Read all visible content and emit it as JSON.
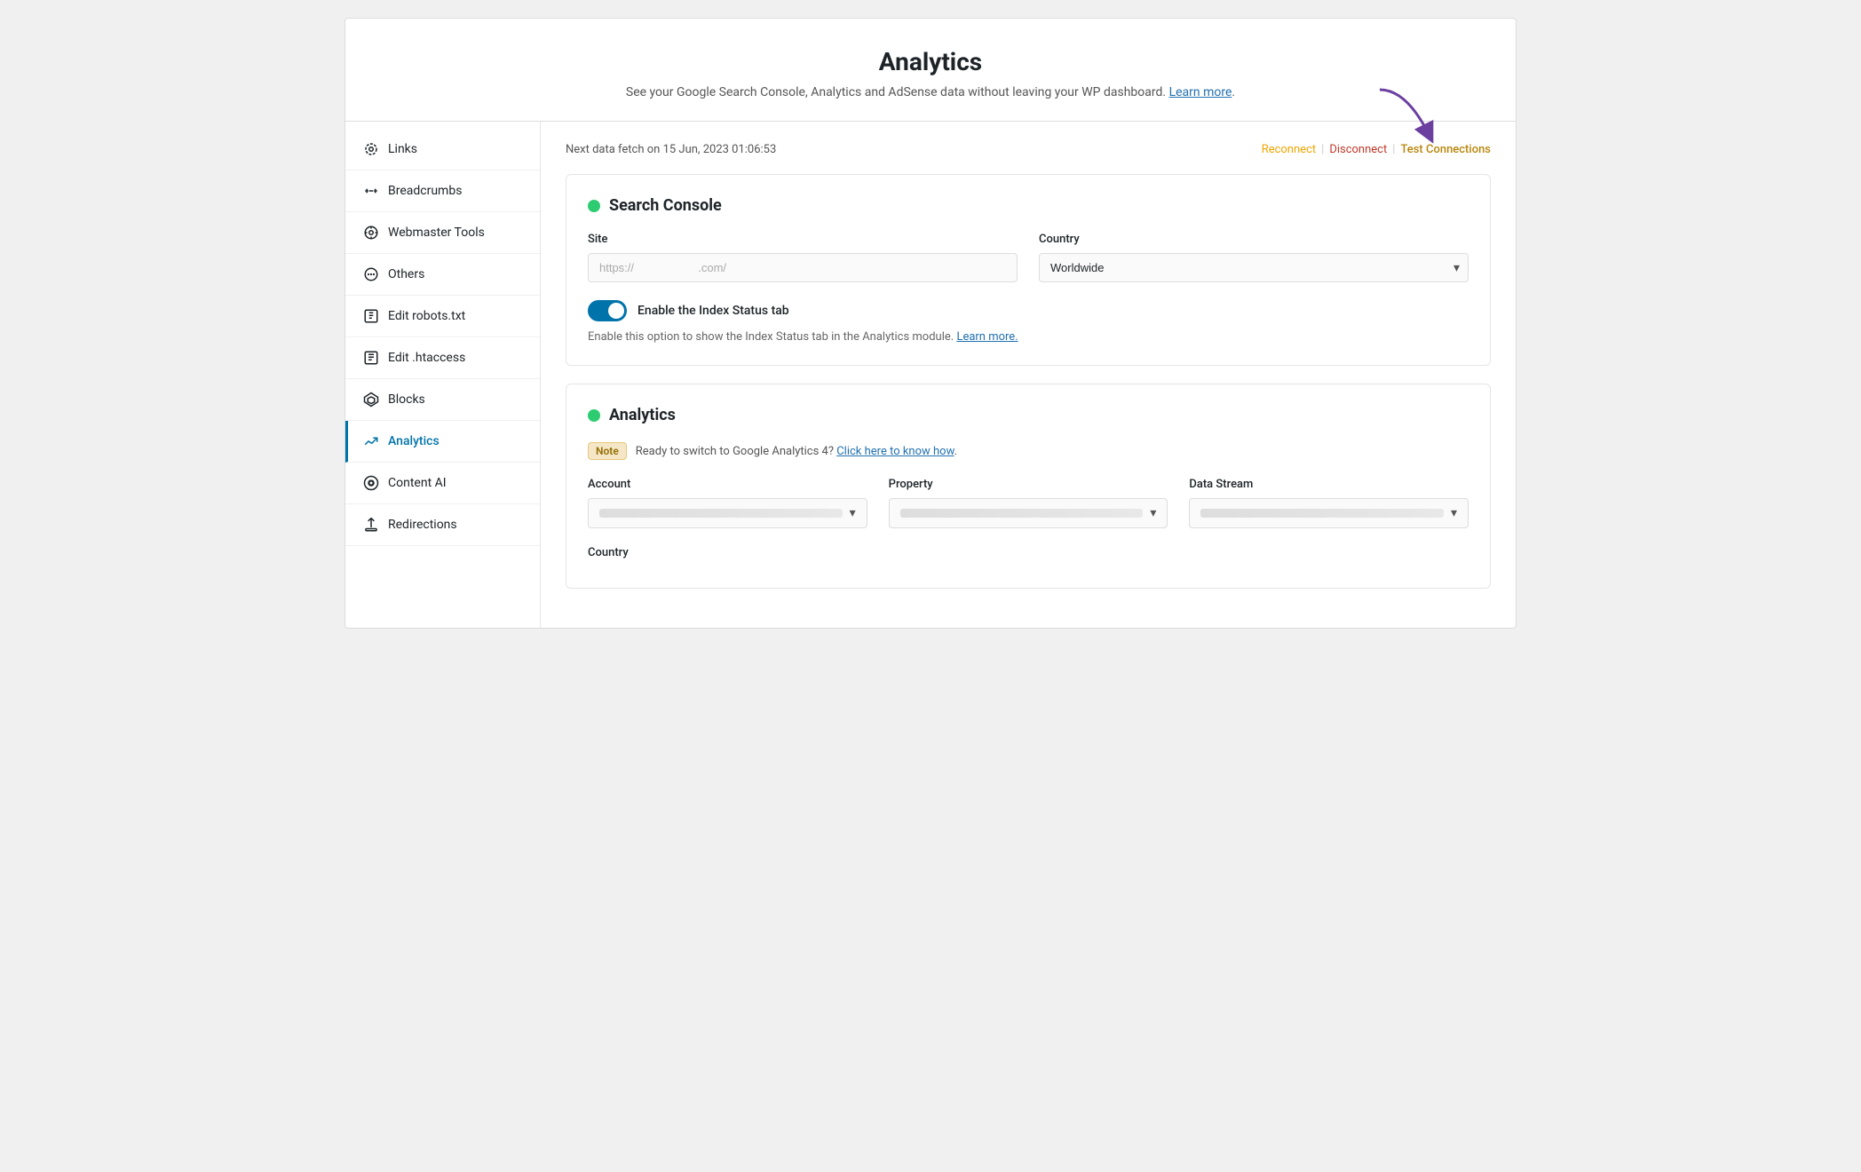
{
  "page": {
    "title": "Analytics",
    "subtitle": "See your Google Search Console, Analytics and AdSense data without leaving your WP dashboard.",
    "subtitle_link_text": "Learn more",
    "subtitle_link_url": "#"
  },
  "header": {
    "fetch_text": "Next data fetch on 15 Jun, 2023 01:06:53",
    "reconnect_label": "Reconnect",
    "disconnect_label": "Disconnect",
    "test_connections_label": "Test Connections"
  },
  "sidebar": {
    "items": [
      {
        "id": "links",
        "label": "Links",
        "active": false
      },
      {
        "id": "breadcrumbs",
        "label": "Breadcrumbs",
        "active": false
      },
      {
        "id": "webmaster-tools",
        "label": "Webmaster Tools",
        "active": false
      },
      {
        "id": "others",
        "label": "Others",
        "active": false
      },
      {
        "id": "edit-robots",
        "label": "Edit robots.txt",
        "active": false
      },
      {
        "id": "edit-htaccess",
        "label": "Edit .htaccess",
        "active": false
      },
      {
        "id": "blocks",
        "label": "Blocks",
        "active": false
      },
      {
        "id": "analytics",
        "label": "Analytics",
        "active": true
      },
      {
        "id": "content-ai",
        "label": "Content AI",
        "active": false
      },
      {
        "id": "redirections",
        "label": "Redirections",
        "active": false
      }
    ]
  },
  "search_console": {
    "title": "Search Console",
    "site_label": "Site",
    "site_placeholder": "https://               .com/",
    "country_label": "Country",
    "country_value": "Worldwide",
    "toggle_label": "Enable the Index Status tab",
    "toggle_description": "Enable this option to show the Index Status tab in the Analytics module.",
    "toggle_learn_more": "Learn more.",
    "toggle_learn_more_url": "#"
  },
  "analytics": {
    "title": "Analytics",
    "note_badge": "Note",
    "note_text": "Ready to switch to Google Analytics 4?",
    "note_link_text": "Click here to know how",
    "note_link_url": "#",
    "account_label": "Account",
    "property_label": "Property",
    "data_stream_label": "Data Stream",
    "country_label": "Country"
  }
}
